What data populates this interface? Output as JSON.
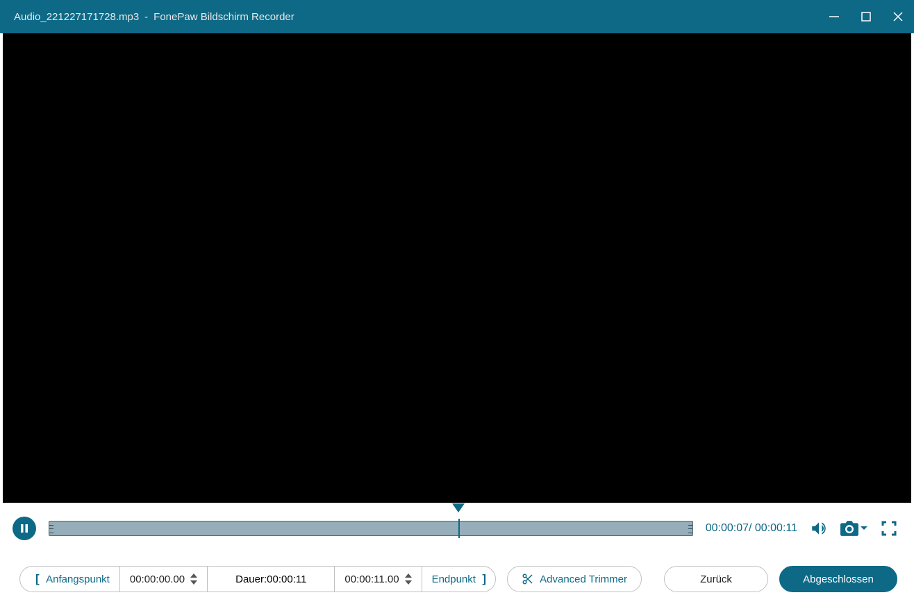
{
  "titlebar": {
    "filename": "Audio_221227171728.mp3",
    "separator": "  -  ",
    "app_name": "FonePaw Bildschirm Recorder"
  },
  "playback": {
    "current_time": "00:00:07",
    "total_time": "00:00:11",
    "time_display": "00:00:07/ 00:00:11"
  },
  "trim": {
    "start_label": "Anfangspunkt",
    "start_value": "00:00:00.00",
    "duration_label": "Dauer:",
    "duration_value": "00:00:11",
    "end_value": "00:00:11.00",
    "end_label": "Endpunkt"
  },
  "buttons": {
    "advanced_trimmer": "Advanced Trimmer",
    "back": "Zurück",
    "done": "Abgeschlossen"
  }
}
